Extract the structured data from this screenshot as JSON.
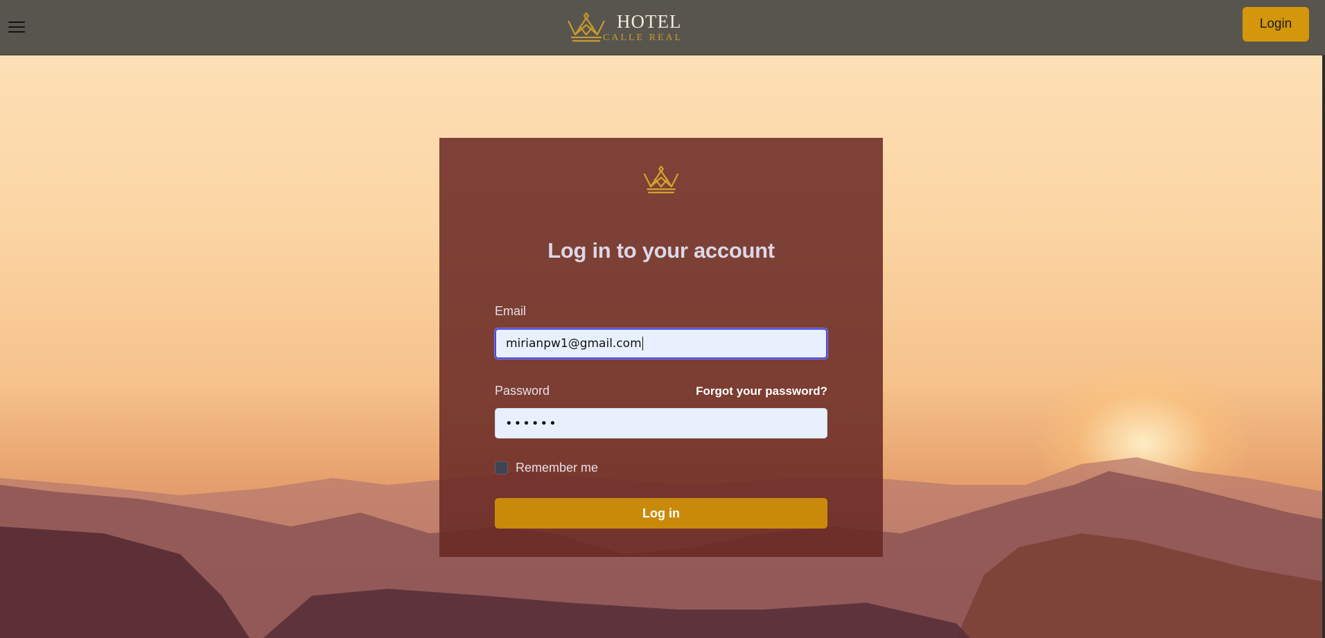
{
  "header": {
    "brand_line1": "HOTEL",
    "brand_line2": "CALLE REAL",
    "menu_icon": "hamburger-menu-icon",
    "login_label": "Login"
  },
  "form": {
    "title": "Log in to your account",
    "email_label": "Email",
    "email_value": "mirianpw1@gmail.com",
    "password_label": "Password",
    "forgot_label": "Forgot your password?",
    "password_value": "••••••",
    "remember_label": "Remember me",
    "remember_checked": false,
    "submit_label": "Log in"
  },
  "colors": {
    "topbar": "#58554f",
    "accent": "#d4960a",
    "card": "#682824",
    "input_bg": "#e8f0fe",
    "focus_border": "#4b48d8"
  }
}
